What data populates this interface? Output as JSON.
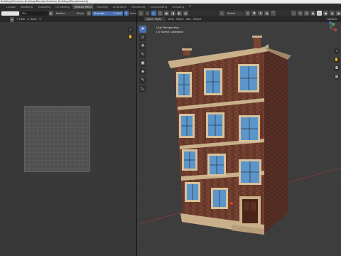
{
  "window": {
    "title": "Building/YCartoon_Building/Blender/Cartoon_Building/Blender.blend]"
  },
  "tabs": [
    {
      "label": "Layout",
      "active": false
    },
    {
      "label": "Modeling",
      "active": false
    },
    {
      "label": "Sculpting",
      "active": false
    },
    {
      "label": "UV Editing",
      "active": false
    },
    {
      "label": "Texture Paint",
      "active": true
    },
    {
      "label": "Shading",
      "active": false
    },
    {
      "label": "Animation",
      "active": false
    },
    {
      "label": "Rendering",
      "active": false
    },
    {
      "label": "Compositing",
      "active": false
    },
    {
      "label": "Scripting",
      "active": false
    }
  ],
  "tab_add": "+",
  "image_editor_header": {
    "mix_label": "Mix",
    "radius_label": "Radius",
    "radius_value": "50 px",
    "strength_label": "Strength",
    "strength_value": "1.000",
    "advanced_label": "Adva"
  },
  "image_editor_subheader": {
    "new_label": "New",
    "open_label": "Open"
  },
  "viewport_header": {
    "global_label": "Global",
    "options_label": "Options"
  },
  "viewport_subheader": {
    "mode_label": "Object Mode",
    "menus": [
      "View",
      "Select",
      "Add",
      "Object"
    ]
  },
  "viewport_info": {
    "perspective": "User Perspective",
    "collection": "(1) Scene Collection"
  },
  "gizmo": {
    "x": "X",
    "y": "Y",
    "z": "Z"
  },
  "colors": {
    "accent": "#4772b3",
    "brick": "#6a3a2e",
    "stone": "#c9b08a",
    "window_glass": "#5c95c9",
    "door": "#4a2418"
  }
}
